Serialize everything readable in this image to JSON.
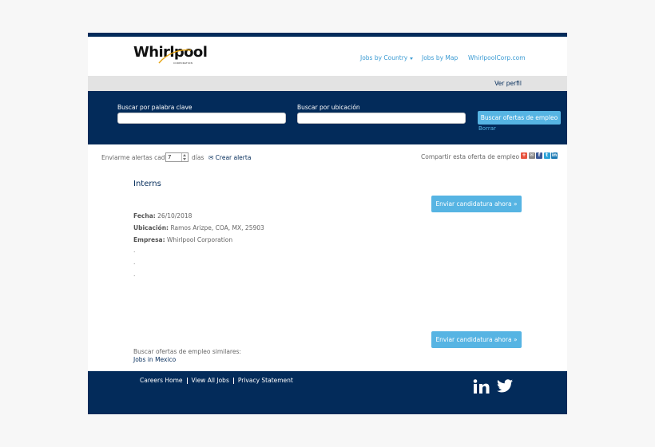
{
  "brand": {
    "logo_word": "Whirlpool",
    "logo_sub": "CORPORATION"
  },
  "nav": {
    "jobs_by_country": "Jobs by Country",
    "jobs_by_map": "Jobs by Map",
    "corp_link": "WhirlpoolCorp.com",
    "profile": "Ver perfil"
  },
  "search": {
    "keyword_label": "Buscar por palabra clave",
    "keyword_value": "",
    "location_label": "Buscar por ubicación",
    "location_value": "",
    "button": "Buscar ofertas de empleo",
    "clear": "Borrar"
  },
  "alerts": {
    "prefix": "Enviarme alertas cada",
    "interval": "7",
    "unit": "días",
    "create": "Crear alerta",
    "share_label": "Compartir esta oferta de empleo"
  },
  "share_icons": [
    {
      "icon": "share-plus-icon",
      "glyph": "+",
      "color": "#e8543f"
    },
    {
      "icon": "email-icon",
      "glyph": "✉",
      "color": "#888888"
    },
    {
      "icon": "facebook-icon",
      "glyph": "f",
      "color": "#3b5998"
    },
    {
      "icon": "twitter-icon",
      "glyph": "t",
      "color": "#2ba1d8"
    },
    {
      "icon": "linkedin-icon",
      "glyph": "in",
      "color": "#1c7ab4"
    }
  ],
  "job": {
    "title": "Interns",
    "apply": "Enviar candidatura ahora »",
    "fecha_label": "Fecha:",
    "fecha": "26/10/2018",
    "ubicacion_label": "Ubicación:",
    "ubicacion": "Ramos Arizpe, COA, MX, 25903",
    "empresa_label": "Empresa:",
    "empresa": "Whirlpool Corporation",
    "dots": [
      ".",
      ".",
      "."
    ]
  },
  "similar": {
    "label": "Buscar ofertas de empleo similares:",
    "link": "Jobs in Mexico"
  },
  "footer": {
    "links": [
      "Careers Home",
      "View All Jobs",
      "Privacy Statement"
    ]
  },
  "colors": {
    "navy": "#032b5a",
    "accent": "#56b4e3",
    "link": "#3b9bd3"
  }
}
